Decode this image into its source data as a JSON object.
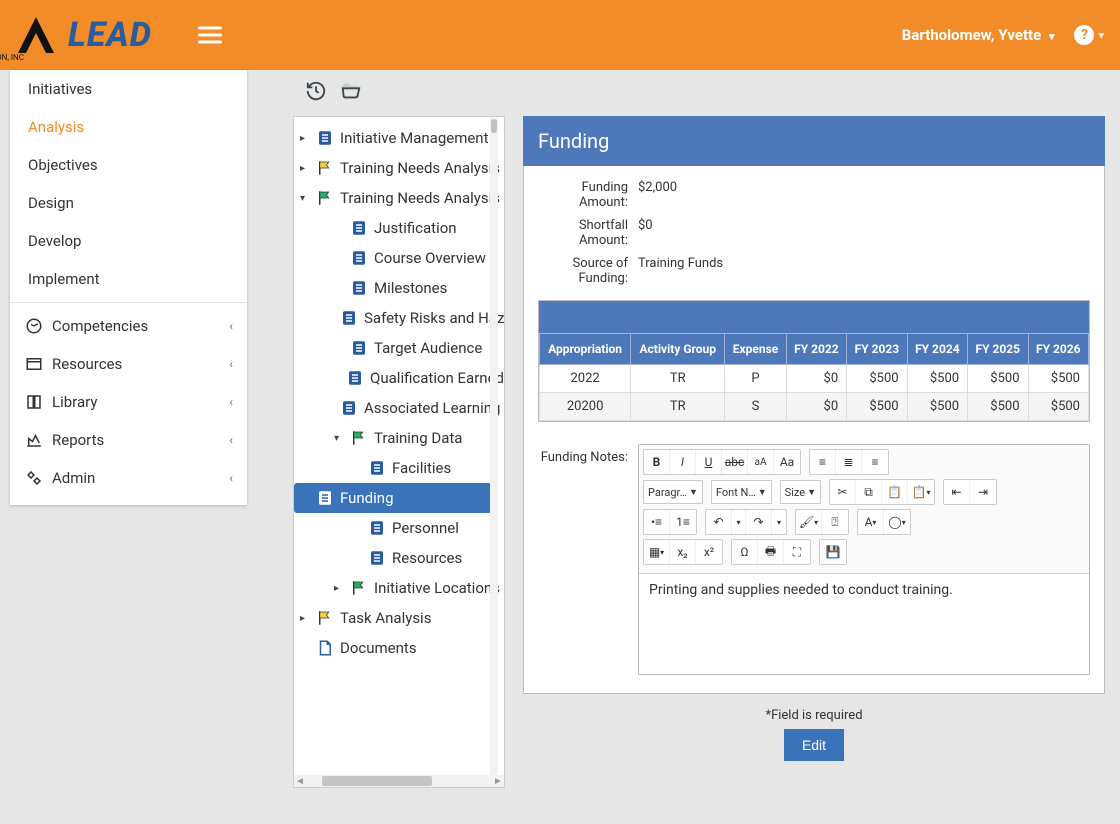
{
  "header": {
    "brand": "LEAD",
    "logo_sub": "AIMERION, INC",
    "user": "Bartholomew, Yvette"
  },
  "sidebar": {
    "top_items": [
      "Initiatives",
      "Analysis",
      "Objectives",
      "Design",
      "Develop",
      "Implement"
    ],
    "active_index": 1,
    "sections": [
      "Competencies",
      "Resources",
      "Library",
      "Reports",
      "Admin"
    ]
  },
  "tree": [
    {
      "level": 0,
      "exp": "▸",
      "icon": "doc",
      "label": "Initiative Management"
    },
    {
      "level": 0,
      "exp": "▸",
      "icon": "flag-y",
      "label": "Training Needs Analysis"
    },
    {
      "level": 0,
      "exp": "▾",
      "icon": "flag-g",
      "label": "Training Needs Analysis"
    },
    {
      "level": 1,
      "exp": "",
      "icon": "doc",
      "label": "Justification"
    },
    {
      "level": 1,
      "exp": "",
      "icon": "doc",
      "label": "Course Overview"
    },
    {
      "level": 1,
      "exp": "",
      "icon": "doc",
      "label": "Milestones"
    },
    {
      "level": 1,
      "exp": "",
      "icon": "doc",
      "label": "Safety Risks and Hazards"
    },
    {
      "level": 1,
      "exp": "",
      "icon": "doc",
      "label": "Target Audience"
    },
    {
      "level": 1,
      "exp": "",
      "icon": "doc",
      "label": "Qualification Earned"
    },
    {
      "level": 1,
      "exp": "",
      "icon": "doc",
      "label": "Associated Learning Events"
    },
    {
      "level": 1,
      "exp": "▾",
      "icon": "flag-g",
      "label": "Training Data"
    },
    {
      "level": 2,
      "exp": "",
      "icon": "doc",
      "label": "Facilities"
    },
    {
      "level": 2,
      "exp": "",
      "icon": "doc",
      "label": "Funding",
      "selected": true
    },
    {
      "level": 2,
      "exp": "",
      "icon": "doc",
      "label": "Personnel"
    },
    {
      "level": 2,
      "exp": "",
      "icon": "doc",
      "label": "Resources"
    },
    {
      "level": 1,
      "exp": "▸",
      "icon": "flag-g",
      "label": "Initiative Locations"
    },
    {
      "level": 0,
      "exp": "▸",
      "icon": "flag-y",
      "label": "Task Analysis"
    },
    {
      "level": 0,
      "exp": "",
      "icon": "page",
      "label": "Documents"
    }
  ],
  "detail": {
    "title": "Funding",
    "kv": [
      {
        "label": "Funding Amount:",
        "value": "$2,000"
      },
      {
        "label": "Shortfall Amount:",
        "value": "$0"
      },
      {
        "label": "Source of Funding:",
        "value": "Training Funds"
      }
    ],
    "table": {
      "headers": [
        "Appropriation",
        "Activity Group",
        "Expense",
        "FY 2022",
        "FY 2023",
        "FY 2024",
        "FY 2025",
        "FY 2026"
      ],
      "rows": [
        [
          "2022",
          "TR",
          "P",
          "$0",
          "$500",
          "$500",
          "$500",
          "$500"
        ],
        [
          "20200",
          "TR",
          "S",
          "$0",
          "$500",
          "$500",
          "$500",
          "$500"
        ]
      ]
    },
    "editor_label": "Funding Notes:",
    "editor_text": "Printing and supplies needed to conduct training.",
    "toolbar": {
      "paragraph": "Paragr…",
      "font": "Font N…",
      "size": "Size"
    },
    "required": "*Field is required",
    "edit_btn": "Edit"
  }
}
